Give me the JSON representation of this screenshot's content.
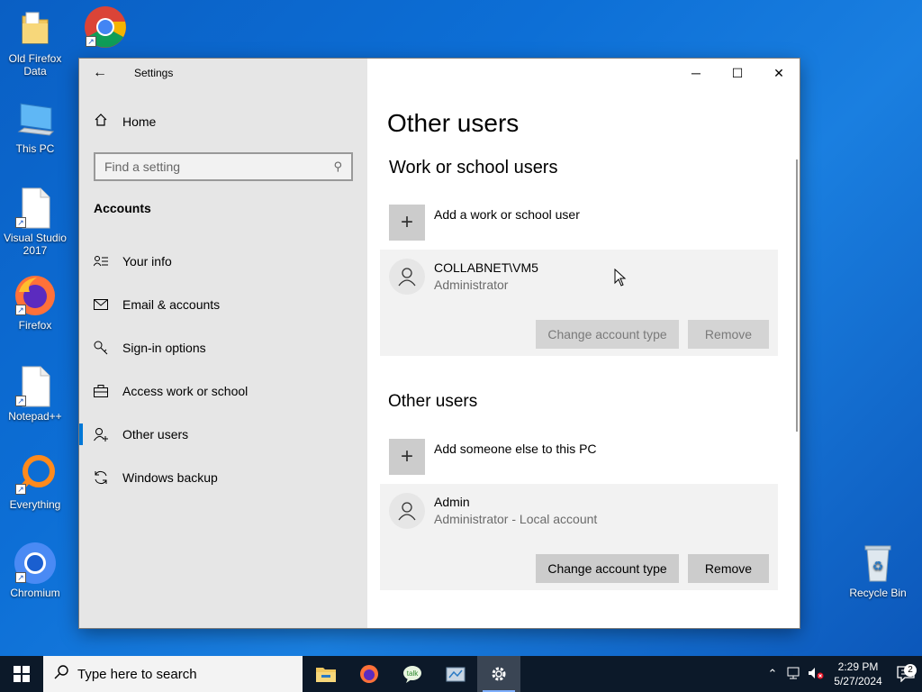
{
  "desktop": {
    "icons": [
      {
        "label": "Old Firefox Data",
        "icon": "folder-icon"
      },
      {
        "label": "Google Chrome",
        "icon": "chrome-icon"
      },
      {
        "label": "This PC",
        "icon": "computer-icon"
      },
      {
        "label": "Visual Studio 2017",
        "icon": "file-icon"
      },
      {
        "label": "Firefox",
        "icon": "firefox-icon"
      },
      {
        "label": "Notepad++",
        "icon": "file-icon"
      },
      {
        "label": "Everything",
        "icon": "everything-icon"
      },
      {
        "label": "Chromium",
        "icon": "chromium-icon"
      },
      {
        "label": "Recycle Bin",
        "icon": "recycle-bin-icon"
      }
    ]
  },
  "window": {
    "title": "Settings",
    "controls": {
      "minimize": "─",
      "maximize": "☐",
      "close": "✕"
    }
  },
  "sidebar": {
    "home_label": "Home",
    "search_placeholder": "Find a setting",
    "section_label": "Accounts",
    "items": [
      {
        "label": "Your info",
        "icon": "person-card-icon"
      },
      {
        "label": "Email & accounts",
        "icon": "mail-icon"
      },
      {
        "label": "Sign-in options",
        "icon": "key-icon"
      },
      {
        "label": "Access work or school",
        "icon": "briefcase-icon"
      },
      {
        "label": "Other users",
        "icon": "add-person-icon",
        "active": true
      },
      {
        "label": "Windows backup",
        "icon": "sync-icon"
      }
    ]
  },
  "main": {
    "page_title": "Other users",
    "work_section": {
      "title": "Work or school users",
      "add_label": "Add a work or school user",
      "user": {
        "name": "COLLABNET\\VM5",
        "role": "Administrator",
        "change_label": "Change account type",
        "remove_label": "Remove"
      }
    },
    "other_section": {
      "title": "Other users",
      "add_label": "Add someone else to this PC",
      "user": {
        "name": "Admin",
        "role": "Administrator - Local account",
        "change_label": "Change account type",
        "remove_label": "Remove"
      }
    }
  },
  "taskbar": {
    "search_placeholder": "Type here to search",
    "apps": [
      "file-explorer-icon",
      "firefox-icon",
      "talk-icon",
      "app-icon",
      "settings-gear-icon"
    ],
    "clock_time": "2:29 PM",
    "clock_date": "5/27/2024",
    "notification_count": "2"
  },
  "colors": {
    "accent": "#0078d7",
    "sidebar_bg": "#e6e6e6",
    "card_bg": "#f2f2f2",
    "taskbar_bg": "#0c1929"
  }
}
